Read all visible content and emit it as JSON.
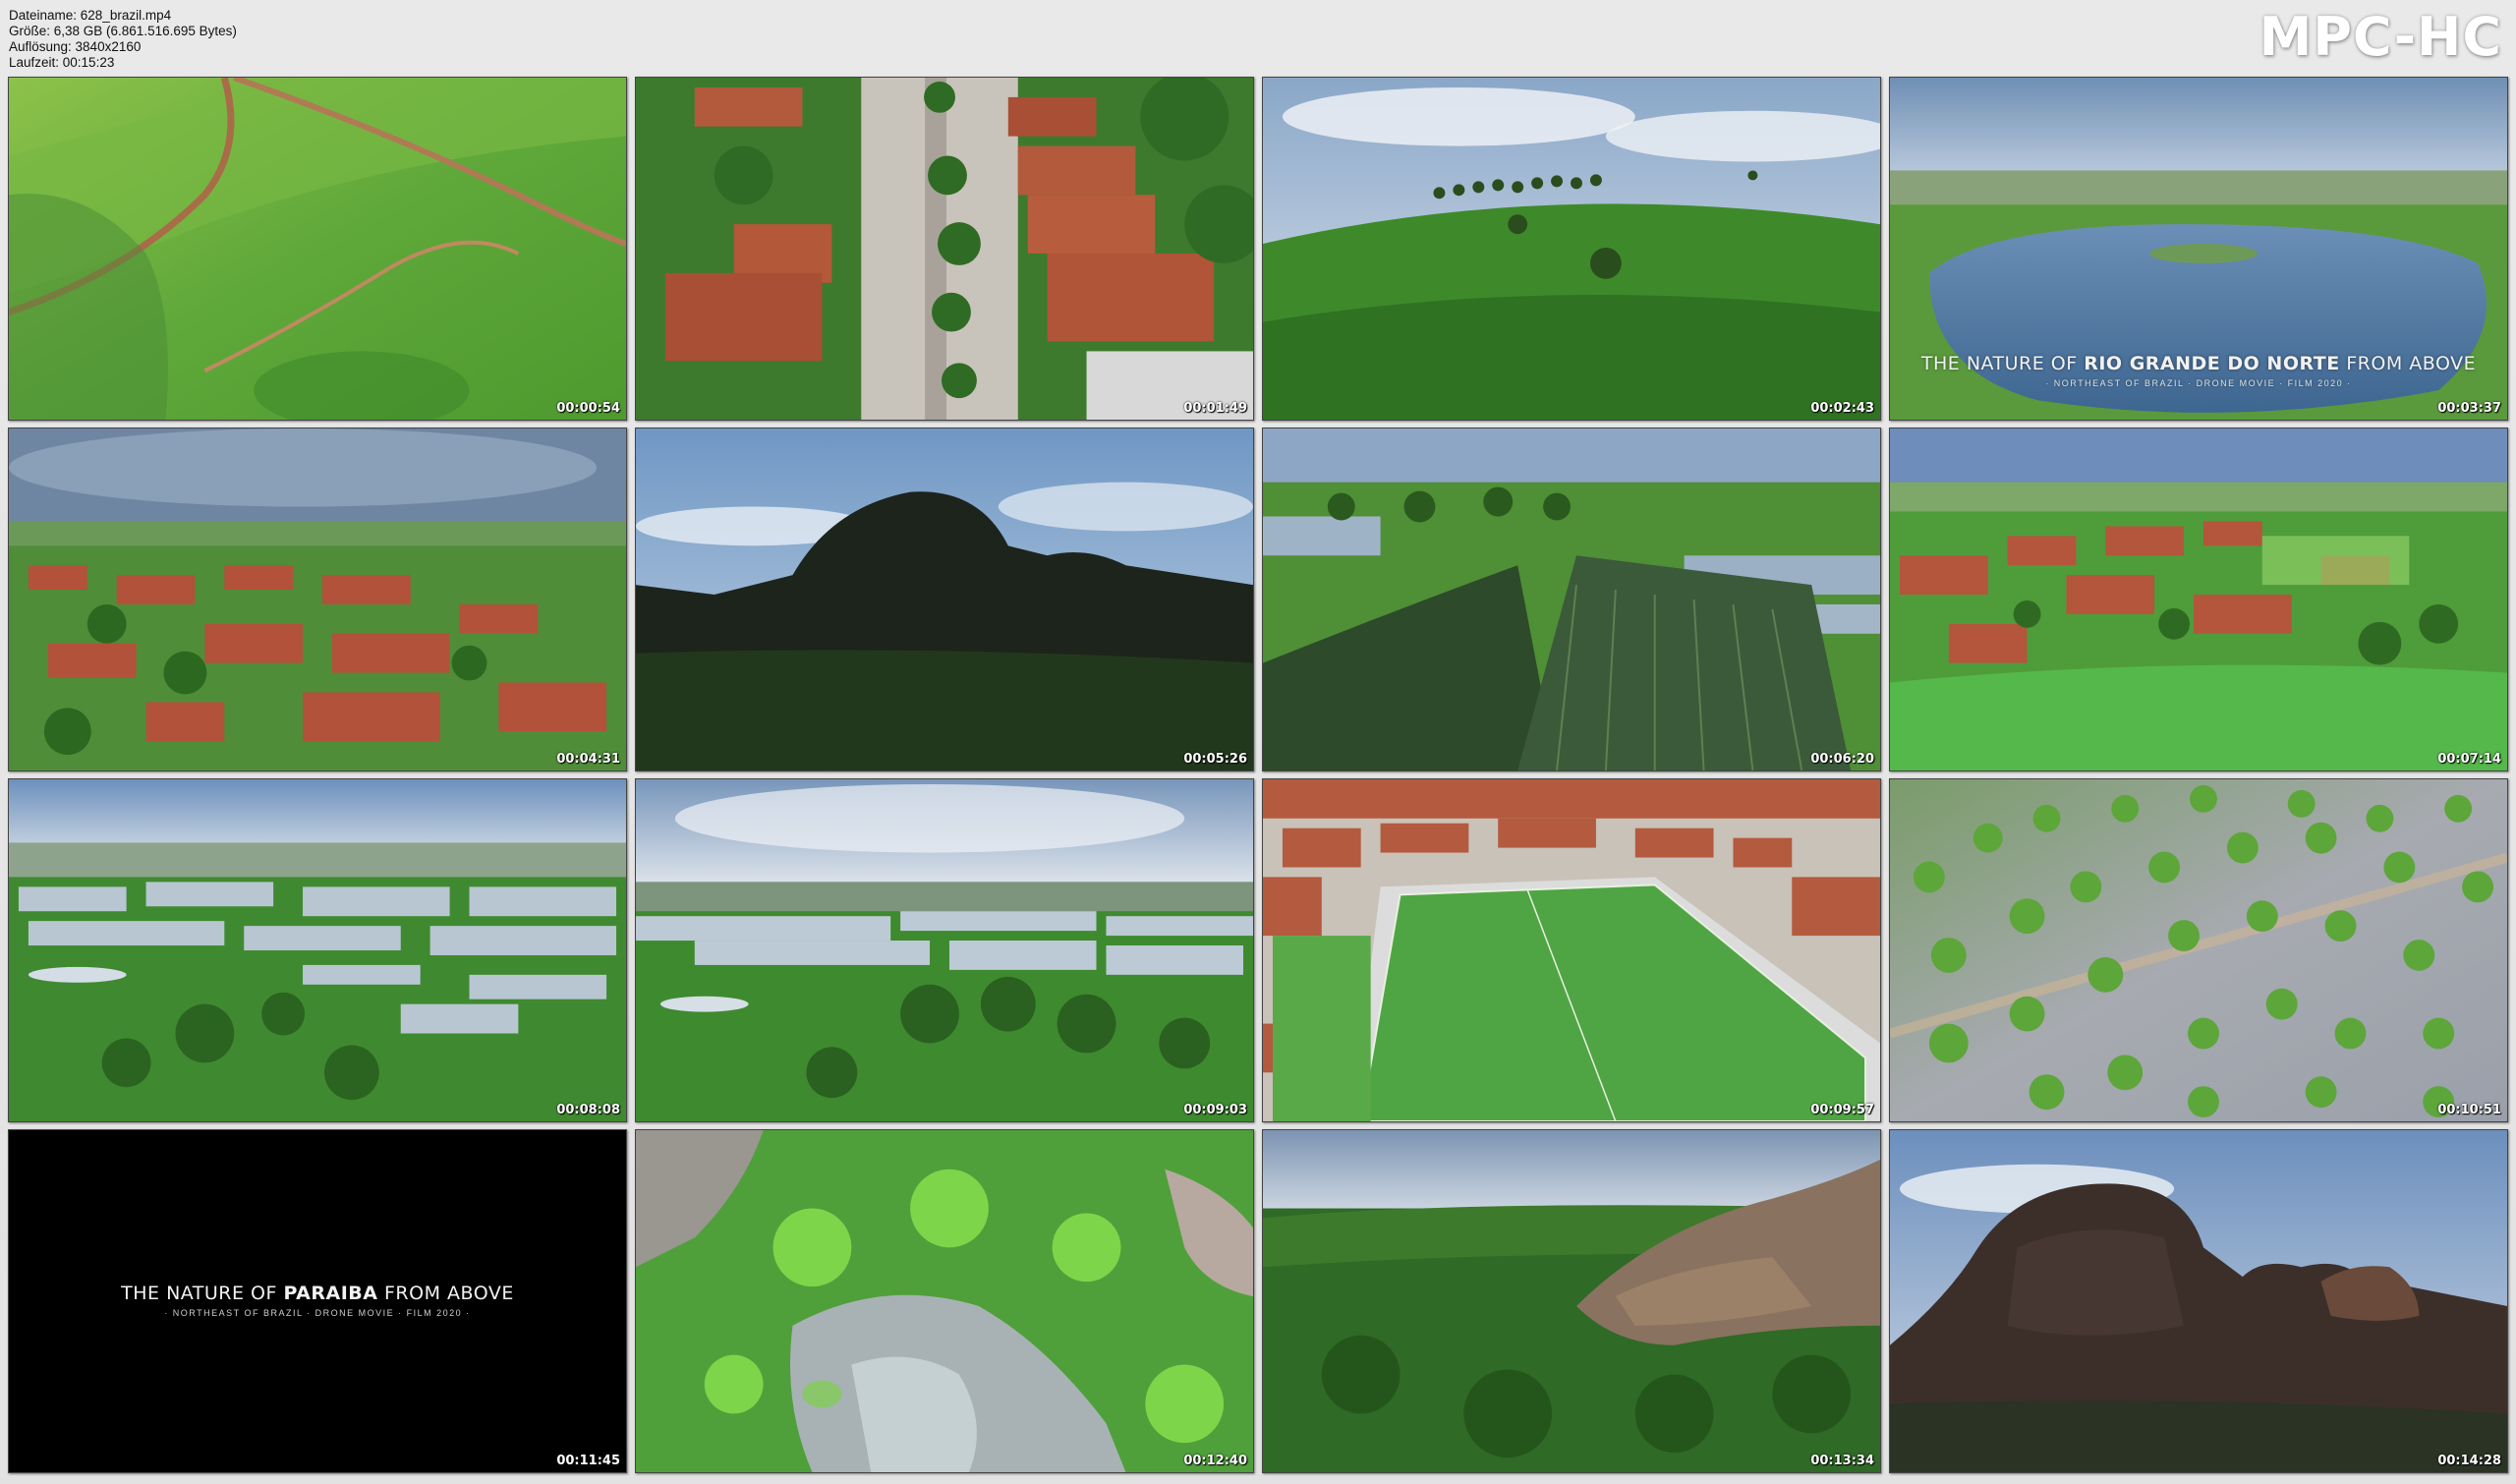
{
  "file_info": {
    "filename": "Dateiname: 628_brazil.mp4",
    "size": "Größe: 6,38 GB (6.861.516.695 Bytes)",
    "resolution": "Auflösung: 3840x2160",
    "duration": "Laufzeit: 00:15:23"
  },
  "brand": "MPC-HC",
  "thumbnails": [
    {
      "time": "00:00:54"
    },
    {
      "time": "00:01:49"
    },
    {
      "time": "00:02:43"
    },
    {
      "time": "00:03:37",
      "title_pre": "THE NATURE OF ",
      "title_bold": "RIO GRANDE DO NORTE",
      "title_post": " FROM ABOVE",
      "subtitle": "· NORTHEAST OF BRAZIL · DRONE MOVIE · FILM 2020 ·"
    },
    {
      "time": "00:04:31"
    },
    {
      "time": "00:05:26"
    },
    {
      "time": "00:06:20"
    },
    {
      "time": "00:07:14"
    },
    {
      "time": "00:08:08"
    },
    {
      "time": "00:09:03"
    },
    {
      "time": "00:09:57"
    },
    {
      "time": "00:10:51"
    },
    {
      "time": "00:11:45",
      "title_pre": "THE NATURE OF ",
      "title_bold": "PARAIBA",
      "title_post": " FROM ABOVE",
      "subtitle": "· NORTHEAST OF BRAZIL · DRONE MOVIE · FILM 2020 ·"
    },
    {
      "time": "00:12:40"
    },
    {
      "time": "00:13:34"
    },
    {
      "time": "00:14:28"
    }
  ]
}
